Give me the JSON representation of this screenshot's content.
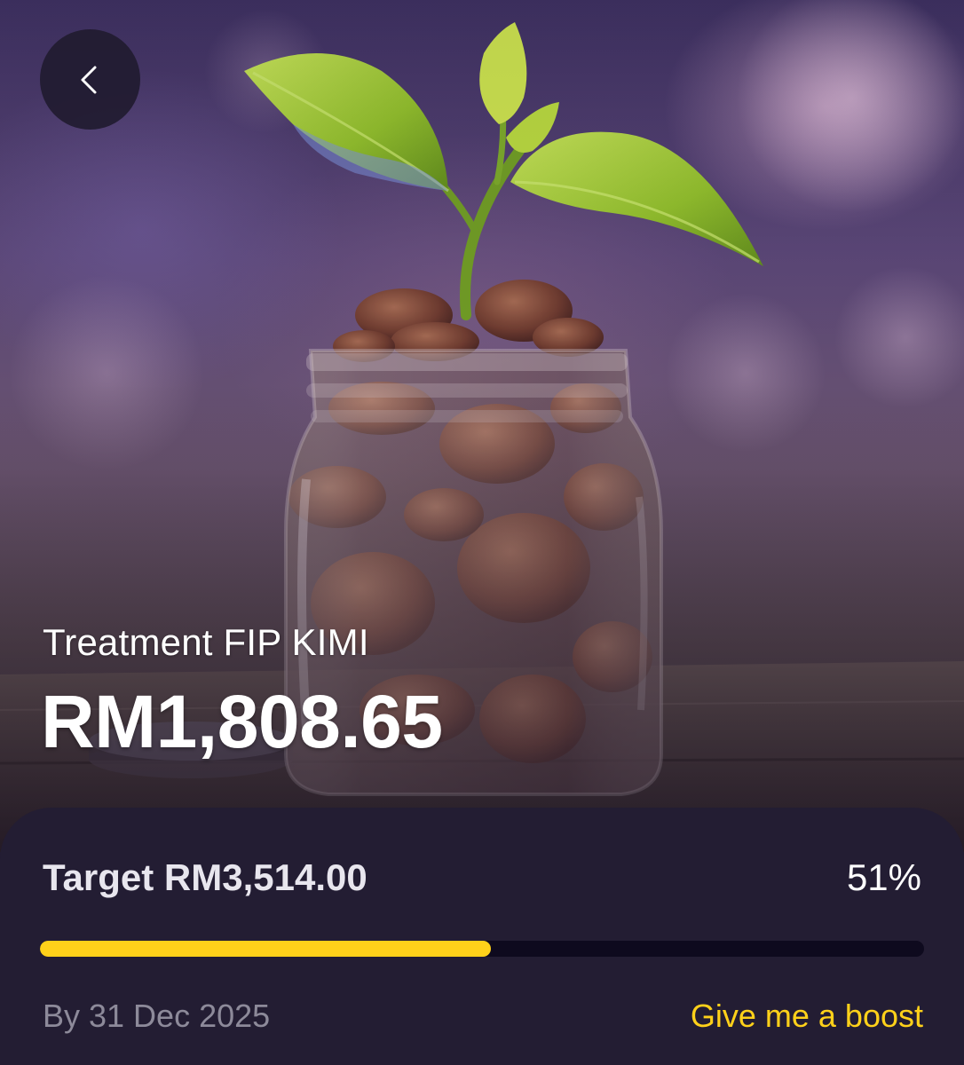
{
  "header": {
    "back_icon": "chevron-left-icon"
  },
  "hero": {
    "image_subject": "plant sprouting from jar of coins",
    "goal_name": "Treatment FIP KIMI",
    "saved_amount": "RM1,808.65"
  },
  "progress_card": {
    "target_label": "Target RM3,514.00",
    "percent_label": "51%",
    "progress_fraction": 0.51,
    "deadline_label": "By 31 Dec 2025",
    "boost_label": "Give me a boost"
  },
  "colors": {
    "accent": "#ffd11a",
    "card_background": "#231d33",
    "track": "#0e0a1e",
    "muted_text": "#8d8a9a"
  }
}
